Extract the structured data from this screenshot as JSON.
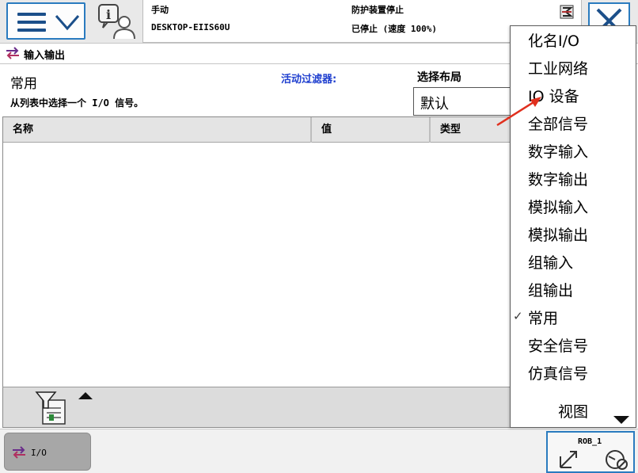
{
  "topbar": {
    "mode": "手动",
    "controller": "DESKTOP-EIIS60U",
    "state": "防护装置停止",
    "speed": "已停止 (速度 100%)"
  },
  "titlebar": {
    "title": "输入输出"
  },
  "main": {
    "subheading": "常用",
    "instruction": "从列表中选择一个 I/O 信号。",
    "filter_label": "活动过滤器:",
    "layout_label": "选择布局",
    "layout_value": "默认",
    "columns": [
      "名称",
      "值",
      "类型"
    ]
  },
  "dropdown": {
    "items": [
      {
        "label": "化名I/O",
        "checked": false
      },
      {
        "label": "工业网络",
        "checked": false
      },
      {
        "label": "IO 设备",
        "checked": false
      },
      {
        "label": "全部信号",
        "checked": false
      },
      {
        "label": "数字输入",
        "checked": false
      },
      {
        "label": "数字输出",
        "checked": false
      },
      {
        "label": "模拟输入",
        "checked": false
      },
      {
        "label": "模拟输出",
        "checked": false
      },
      {
        "label": "组输入",
        "checked": false
      },
      {
        "label": "组输出",
        "checked": false
      },
      {
        "label": "常用",
        "checked": true
      },
      {
        "label": "安全信号",
        "checked": false
      },
      {
        "label": "仿真信号",
        "checked": false
      }
    ],
    "check_mark": "✓",
    "view_label": "视图"
  },
  "taskbar": {
    "task_label": "I/O",
    "rob_label": "ROB_1"
  },
  "colors": {
    "accent_blue": "#2a7bbf",
    "filter_blue": "#1f3fcf",
    "annotation_red": "#e0301e"
  },
  "icons": {
    "menu": "hamburger-icon",
    "menu_chevron": "chevron-down-icon",
    "info": "info-user-icon",
    "status": "status-stack-icon",
    "close": "close-icon",
    "io": "io-exchange-icon",
    "filter": "filter-funnel-icon",
    "sort_up": "arrow-up-icon",
    "view_expand": "arrow-down-icon",
    "jog": "jog-axes-icon",
    "speed": "speed-lock-icon"
  }
}
